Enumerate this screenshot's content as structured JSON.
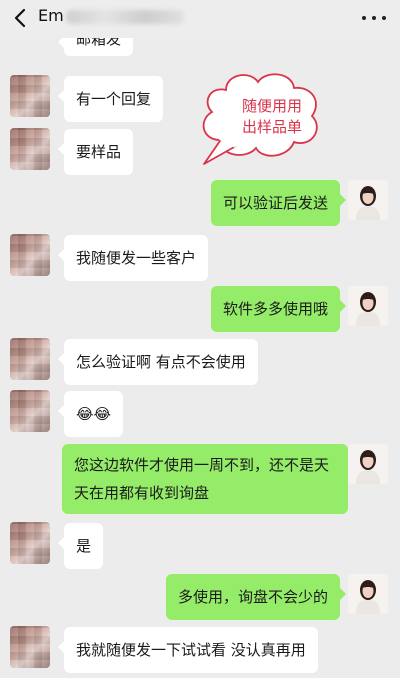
{
  "header": {
    "title_visible": "Em",
    "back_icon": "chevron-left-icon",
    "more_icon": "more-dots-icon"
  },
  "annotation": {
    "line1": "随便用用",
    "line2": "出样品单",
    "color": "#d9344a"
  },
  "colors": {
    "left_bubble": "#ffffff",
    "right_bubble": "#95ec69",
    "background": "#ececec"
  },
  "messages": [
    {
      "side": "left",
      "text": "邮箱发"
    },
    {
      "side": "left",
      "text": "有一个回复"
    },
    {
      "side": "left",
      "text": "要样品"
    },
    {
      "side": "right",
      "text": "可以验证后发送"
    },
    {
      "side": "left",
      "text": "我随便发一些客户"
    },
    {
      "side": "right",
      "text": "软件多多使用哦"
    },
    {
      "side": "left",
      "text": "怎么验证啊 有点不会使用"
    },
    {
      "side": "left",
      "text": "😂😂"
    },
    {
      "side": "right",
      "text": "您这边软件才使用一周不到，还不是天天在用都有收到询盘"
    },
    {
      "side": "left",
      "text": "是"
    },
    {
      "side": "right",
      "text": "多使用，询盘不会少的"
    },
    {
      "side": "left",
      "text": "我就随便发一下试试看 没认真再用"
    }
  ]
}
